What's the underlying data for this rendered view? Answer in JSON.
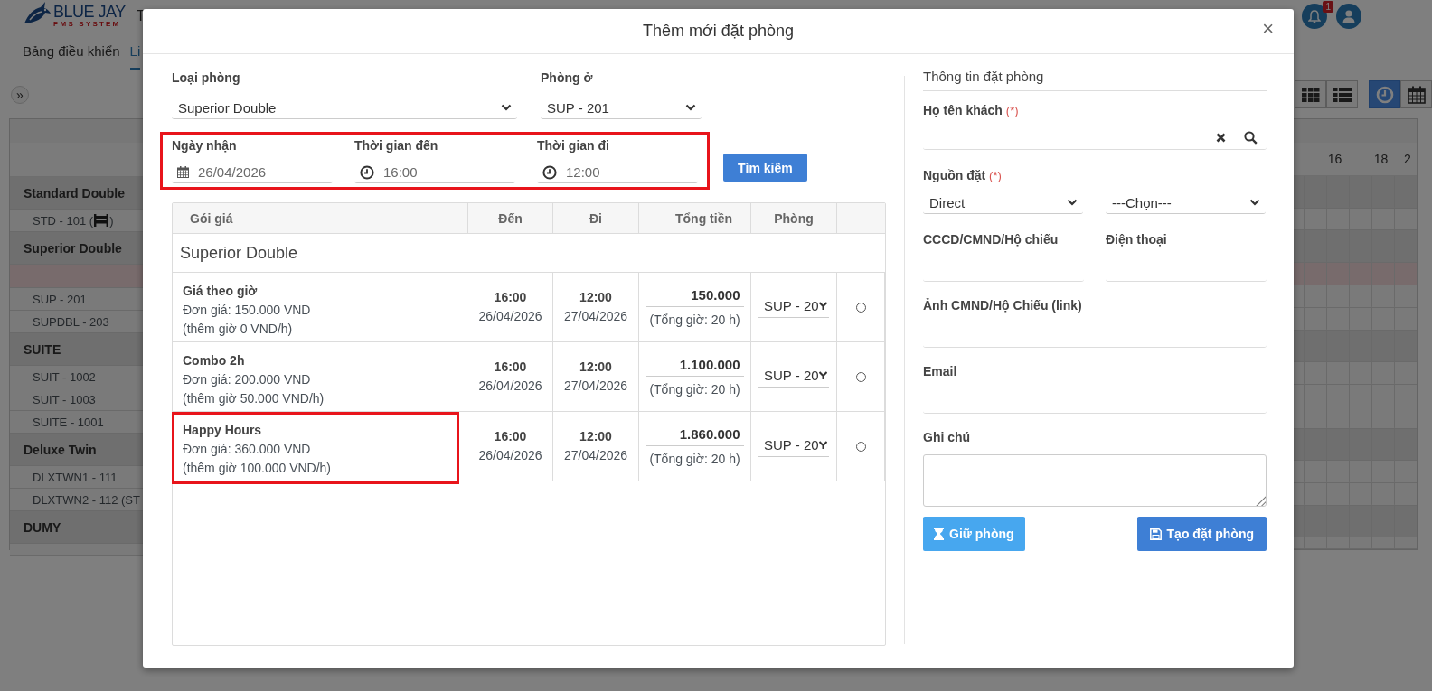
{
  "header": {
    "logo_title": "BLUE JAY",
    "logo_subtitle": "PMS SYSTEM",
    "menu_cut": "T",
    "notification_count": "1"
  },
  "nav": [
    {
      "label": "Bảng điều khiển",
      "selected": false
    },
    {
      "label": "Li",
      "selected": true
    }
  ],
  "toolbar": {
    "expand": "»",
    "view_buttons": [
      {
        "kind": "grid",
        "selected": false
      },
      {
        "kind": "list",
        "selected": false
      },
      {
        "kind": "clock",
        "selected": true
      },
      {
        "kind": "calendar",
        "selected": false
      }
    ]
  },
  "timeline": {
    "hours": [
      "16",
      "18",
      "2"
    ],
    "rows": [
      {
        "kind": "group",
        "label": "Standard Double"
      },
      {
        "kind": "bed_room",
        "label": "STD - 101 (",
        "suffix": ")"
      },
      {
        "kind": "group",
        "label": "Superior Double"
      },
      {
        "kind": "marked"
      },
      {
        "kind": "room",
        "label": "SUP - 201"
      },
      {
        "kind": "room",
        "label": "SUPDBL - 203"
      },
      {
        "kind": "group",
        "label": "SUITE"
      },
      {
        "kind": "room",
        "label": "SUIT - 1002"
      },
      {
        "kind": "room",
        "label": "SUIT - 1003"
      },
      {
        "kind": "room",
        "label": "SUITE - 1001"
      },
      {
        "kind": "group",
        "label": "Deluxe Twin"
      },
      {
        "kind": "room",
        "label": "DLXTWN1 - 111"
      },
      {
        "kind": "room",
        "label": "DLXTWN2 - 112 (ST"
      },
      {
        "kind": "group",
        "label": "DUMY"
      },
      {
        "kind": "blank"
      }
    ]
  },
  "modal": {
    "title": "Thêm mới đặt phòng",
    "close": "×",
    "search": {
      "room_type": {
        "label": "Loại phòng",
        "value": "Superior Double"
      },
      "room": {
        "label": "Phòng ở",
        "value": "SUP - 201"
      },
      "highlighted": true,
      "date_fields": [
        {
          "kind": "date",
          "label": "Ngày nhận",
          "value": "26/04/2026"
        },
        {
          "kind": "time",
          "label": "Thời gian đến",
          "value": "16:00"
        },
        {
          "kind": "time",
          "label": "Thời gian đi",
          "value": "12:00"
        }
      ],
      "button": "Tìm kiếm"
    },
    "rates": {
      "columns": [
        "Gói giá",
        "Đến",
        "Đi",
        "Tổng tiền",
        "Phòng"
      ],
      "group": "Superior Double",
      "rows": [
        {
          "name": "Giá theo giờ",
          "price": "Đơn giá: 150.000 VND",
          "extra": "(thêm giờ 0 VND/h)",
          "arrive_time": "16:00",
          "arrive_date": "26/04/2026",
          "leave_time": "12:00",
          "leave_date": "27/04/2026",
          "total": "150.000",
          "hours": "(Tổng giờ: 20 h)",
          "room": "SUP - 20",
          "selected": false,
          "highlighted": false
        },
        {
          "name": "Combo 2h",
          "price": "Đơn giá: 200.000 VND",
          "extra": "(thêm giờ 50.000 VND/h)",
          "arrive_time": "16:00",
          "arrive_date": "26/04/2026",
          "leave_time": "12:00",
          "leave_date": "27/04/2026",
          "total": "1.100.000",
          "hours": "(Tổng giờ: 20 h)",
          "room": "SUP - 20",
          "selected": false,
          "highlighted": false
        },
        {
          "name": "Happy Hours",
          "price": "Đơn giá: 360.000 VND",
          "extra": "(thêm giờ 100.000 VND/h)",
          "arrive_time": "16:00",
          "arrive_date": "26/04/2026",
          "leave_time": "12:00",
          "leave_date": "27/04/2026",
          "total": "1.860.000",
          "hours": "(Tổng giờ: 20 h)",
          "room": "SUP - 20",
          "selected": false,
          "highlighted": true
        }
      ]
    },
    "booking": {
      "title": "Thông tin đặt phòng",
      "guest_name": {
        "label": "Họ tên khách",
        "required_mark": "(*)"
      },
      "source": {
        "label": "Nguồn đặt",
        "required_mark": "(*)",
        "value": "Direct",
        "sub_value": "---Chọn---"
      },
      "id_number": {
        "label": "CCCD/CMND/Hộ chiếu"
      },
      "phone": {
        "label": "Điện thoại"
      },
      "id_photo": {
        "label": "Ảnh CMND/Hộ Chiếu (link)"
      },
      "email": {
        "label": "Email"
      },
      "note": {
        "label": "Ghi chú"
      },
      "buttons": [
        {
          "kind": "hold",
          "label": "Giữ phòng"
        },
        {
          "kind": "create",
          "label": "Tạo đặt phòng"
        }
      ]
    }
  }
}
